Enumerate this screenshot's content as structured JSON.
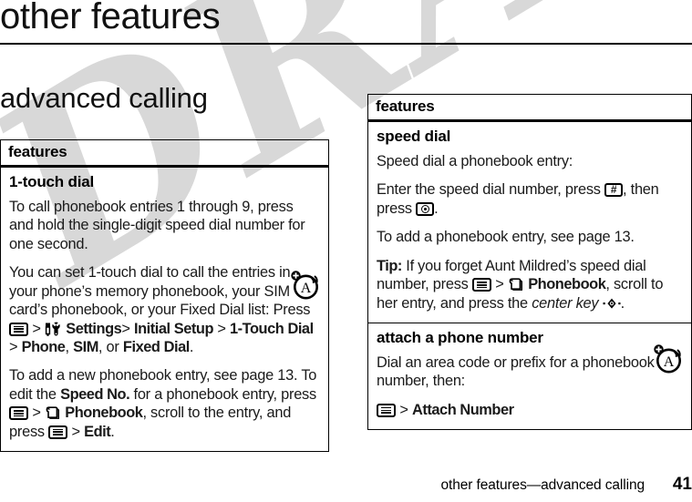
{
  "page": {
    "title": "other features",
    "section_title": "advanced calling",
    "watermark": "DRAFT",
    "footer_text": "other features—advanced calling",
    "footer_page": "41",
    "colors": {
      "text": "#000000",
      "watermark": "#d8d8d8",
      "rule": "#000000"
    }
  },
  "left_table": {
    "header": "features",
    "rows": [
      {
        "title": "1-touch dial",
        "paragraphs": [
          {
            "id": "p1",
            "text": "To call phonebook entries 1 through 9, press and hold the single-digit speed dial number for one second."
          },
          {
            "id": "p2a",
            "text": "You can set 1-touch dial to call the entries in your phone’s memory phonebook, your SIM card’s phonebook, or your Fixed Dial list: Press"
          },
          {
            "id": "p2b_settings",
            "text": "Settings"
          },
          {
            "id": "p2b_initial",
            "text": "Initial Setup"
          },
          {
            "id": "p2b_onetouch",
            "text": "1-Touch Dial"
          },
          {
            "id": "p2b_phone",
            "text": "Phone"
          },
          {
            "id": "p2b_sim",
            "text": "SIM"
          },
          {
            "id": "p2b_or",
            "text": "or"
          },
          {
            "id": "p2b_fixed",
            "text": "Fixed Dial"
          },
          {
            "id": "p3a",
            "text": "To add a new phonebook entry, see page 13. To edit the"
          },
          {
            "id": "p3b_speedno",
            "text": "Speed No."
          },
          {
            "id": "p3c",
            "text": "for a phonebook entry, press"
          },
          {
            "id": "p3d_phonebook",
            "text": "Phonebook"
          },
          {
            "id": "p3e",
            "text": ", scroll to the entry, and press"
          },
          {
            "id": "p3f_edit",
            "text": "Edit"
          }
        ]
      }
    ]
  },
  "right_table": {
    "header": "features",
    "rows": [
      {
        "title": "speed dial",
        "paragraphs": [
          {
            "id": "r1",
            "text": "Speed dial a phonebook entry:"
          },
          {
            "id": "r2a",
            "text": "Enter the speed dial number, press"
          },
          {
            "id": "r2b",
            "text": ", then press"
          },
          {
            "id": "r3",
            "text": "To add a phonebook entry, see page 13."
          },
          {
            "id": "r4_tip",
            "text": "Tip:"
          },
          {
            "id": "r4a",
            "text": "If you forget Aunt Mildred’s speed dial number, press"
          },
          {
            "id": "r4b_phonebook",
            "text": "Phonebook"
          },
          {
            "id": "r4c",
            "text": ", scroll to her entry, and press the"
          },
          {
            "id": "r4d_centerkey",
            "text": "center key"
          }
        ]
      },
      {
        "title": "attach a phone number",
        "paragraphs": [
          {
            "id": "r5",
            "text": "Dial an area code or prefix for a phonebook number, then:"
          },
          {
            "id": "r6_attach",
            "text": "Attach Number"
          }
        ]
      }
    ]
  },
  "icons": {
    "menu_key": "menu-key-icon",
    "settings": "settings-tools-icon",
    "phonebook": "phonebook-icon",
    "hash_key": "hash-key-icon",
    "hash_glyph": "#",
    "send_key": "send-key-icon",
    "center_key": "center-key-icon",
    "margin_note": "note-alert-icon",
    "margin_note_glyph": "A"
  },
  "separators": {
    "gt": ">",
    "comma": ",",
    "period": ".",
    "dot": "·"
  }
}
